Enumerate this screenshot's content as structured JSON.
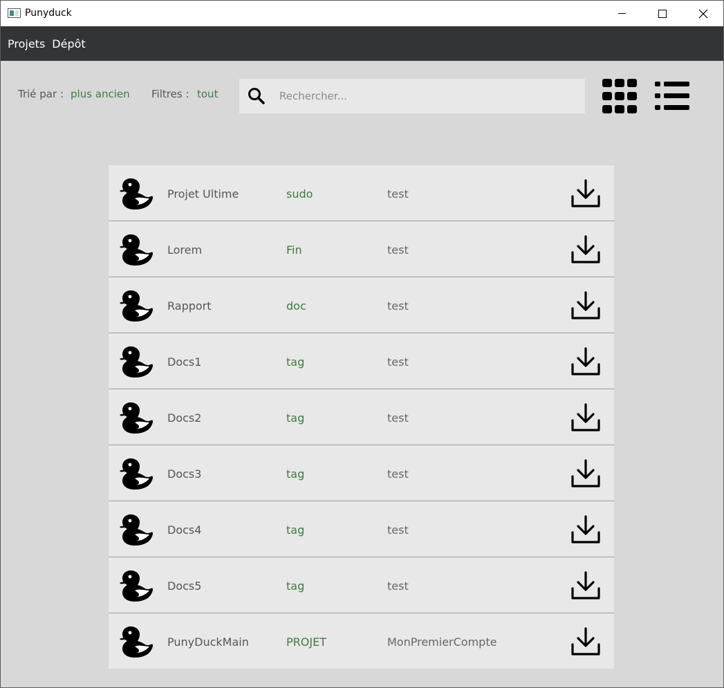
{
  "window": {
    "title": "Punyduck"
  },
  "menubar": {
    "items": [
      {
        "label": "Projets"
      },
      {
        "label": "Dépôt"
      }
    ]
  },
  "toolbar": {
    "sort_label": "Trié par :",
    "sort_value": "plus ancien",
    "filter_label": "Filtres :",
    "filter_value": "tout",
    "search_placeholder": "Rechercher..."
  },
  "colors": {
    "accent_green": "#3f7a3f",
    "menubar_bg": "#333436",
    "content_bg": "#d8d8d8",
    "row_bg": "#e8e8e8"
  },
  "projects": [
    {
      "name": "Projet Ultime",
      "tag": "sudo",
      "owner": "test"
    },
    {
      "name": "Lorem",
      "tag": "Fin",
      "owner": "test"
    },
    {
      "name": "Rapport",
      "tag": "doc",
      "owner": "test"
    },
    {
      "name": "Docs1",
      "tag": "tag",
      "owner": "test"
    },
    {
      "name": "Docs2",
      "tag": "tag",
      "owner": "test"
    },
    {
      "name": "Docs3",
      "tag": "tag",
      "owner": "test"
    },
    {
      "name": "Docs4",
      "tag": "tag",
      "owner": "test"
    },
    {
      "name": "Docs5",
      "tag": "tag",
      "owner": "test"
    },
    {
      "name": "PunyDuckMain",
      "tag": "PROJET",
      "owner": "MonPremierCompte"
    }
  ],
  "icons": {
    "row_icon": "duck-icon",
    "row_action": "download-icon",
    "search": "search-icon",
    "grid_view": "grid-view-icon",
    "list_view": "list-view-icon"
  }
}
